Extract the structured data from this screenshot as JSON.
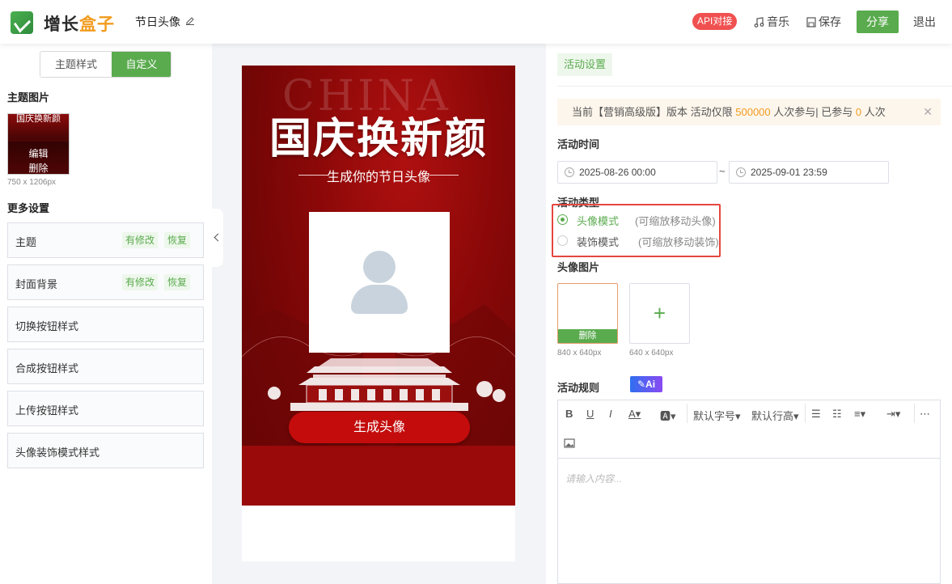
{
  "header": {
    "brand_part1": "增长",
    "brand_part2": "盒子",
    "doc_title": "节日头像",
    "api_badge": "API对接",
    "music": "音乐",
    "save": "保存",
    "share": "分享",
    "logout": "退出"
  },
  "left": {
    "tabs": [
      "主题样式",
      "自定义"
    ],
    "theme_image_title": "主题图片",
    "thumb_title": "国庆换新颜",
    "thumb_edit": "编辑",
    "thumb_delete": "删除",
    "thumb_size": "750 x 1206px",
    "more_settings_title": "更多设置",
    "items": [
      {
        "label": "主题",
        "modified": "有修改",
        "restore": "恢复"
      },
      {
        "label": "封面背景",
        "modified": "有修改",
        "restore": "恢复"
      },
      {
        "label": "切换按钮样式"
      },
      {
        "label": "合成按钮样式"
      },
      {
        "label": "上传按钮样式"
      },
      {
        "label": "头像装饰模式样式"
      }
    ]
  },
  "preview": {
    "bg_text": "CHINA",
    "title": "国庆换新颜",
    "subtitle": "生成你的节日头像",
    "button": "生成头像"
  },
  "right": {
    "tab": "活动设置",
    "notice_prefix": "当前【营销高级版】版本 活动仅限",
    "notice_limit": "500000",
    "notice_mid": "人次参与| 已参与",
    "notice_count": "0",
    "notice_suffix": "人次",
    "time_label": "活动时间",
    "start": "2025-08-26 00:00",
    "end": "2025-09-01 23:59",
    "tilde": "~",
    "type_label": "活动类型",
    "type_options": [
      {
        "label": "头像模式",
        "hint": "(可缩放移动头像)",
        "selected": true
      },
      {
        "label": "装饰模式",
        "hint": "(可缩放移动装饰)",
        "selected": false
      }
    ],
    "avatar_label": "头像图片",
    "avatar_delete": "删除",
    "avatar_size1": "840 x 640px",
    "avatar_size2": "640 x 640px",
    "plus": "+",
    "rules_label": "活动规则",
    "ai_badge": "✎Ai",
    "toolbar": {
      "bold": "B",
      "underline": "U",
      "italic": "I",
      "font_size": "默认字号",
      "line_height": "默认行高"
    },
    "editor_placeholder": "请输入内容..."
  },
  "colors": {
    "accent": "#5aab4e",
    "notice_bg": "#fdf6ec",
    "highlight": "#f29b1f",
    "api": "#f05050",
    "poster": "#8a0808"
  }
}
